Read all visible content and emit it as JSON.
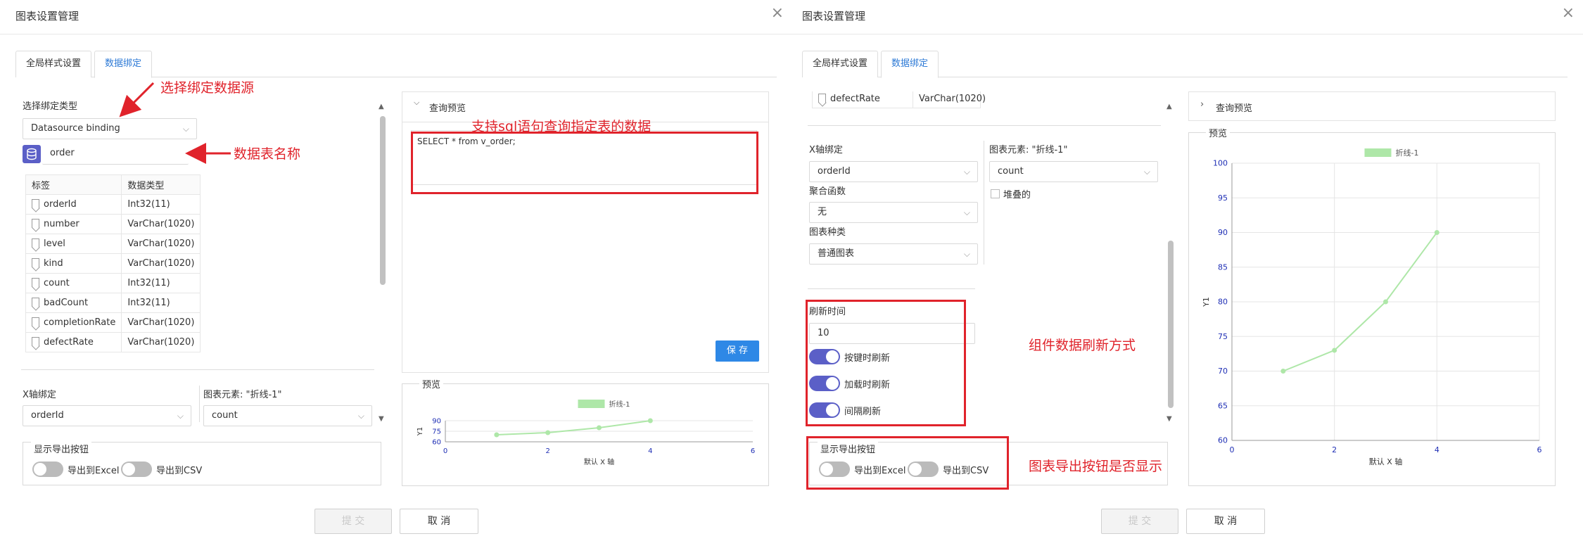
{
  "dialog_title": "图表设置管理",
  "close_symbol": "×",
  "tabs": [
    "全局样式设置",
    "数据绑定"
  ],
  "left": {
    "bind_type_label": "选择绑定类型",
    "bind_type_value": "Datasource binding",
    "table_name": "order",
    "columns_header": [
      "标签",
      "数据类型"
    ],
    "columns": [
      {
        "name": "orderId",
        "type": "Int32(11)"
      },
      {
        "name": "number",
        "type": "VarChar(1020)"
      },
      {
        "name": "level",
        "type": "VarChar(1020)"
      },
      {
        "name": "kind",
        "type": "VarChar(1020)"
      },
      {
        "name": "count",
        "type": "Int32(11)"
      },
      {
        "name": "badCount",
        "type": "Int32(11)"
      },
      {
        "name": "completionRate",
        "type": "VarChar(1020)"
      },
      {
        "name": "defectRate",
        "type": "VarChar(1020)"
      }
    ],
    "xaxis_label": "X轴绑定",
    "xaxis_value": "orderId",
    "element_label": "图表元素: \"折线-1\"",
    "element_value": "count",
    "export_legend": "显示导出按钮",
    "export_excel": "导出到Excel",
    "export_csv": "导出到CSV",
    "query_title": "查询预览",
    "sql": "SELECT * from v_order;",
    "save_label": "保 存",
    "preview_label": "预览"
  },
  "right": {
    "defect_row": {
      "name": "defectRate",
      "type": "VarChar(1020)"
    },
    "xaxis_label": "X轴绑定",
    "xaxis_value": "orderId",
    "element_label": "图表元素: \"折线-1\"",
    "element_value": "count",
    "agg_label": "聚合函数",
    "agg_value": "无",
    "stack_label": "堆叠的",
    "chart_kind_label": "图表种类",
    "chart_kind_value": "普通图表",
    "refresh_label": "刷新时间",
    "refresh_value": "10",
    "refresh_opts": [
      "按键时刷新",
      "加载时刷新",
      "间隔刷新"
    ],
    "export_legend": "显示导出按钮",
    "export_excel": "导出到Excel",
    "export_csv": "导出到CSV",
    "query_title": "查询预览",
    "preview_label": "预览"
  },
  "footer": {
    "submit": "提 交",
    "cancel": "取 消"
  },
  "annotations": {
    "a1": "选择绑定数据源",
    "a2": "数据表名称",
    "a3": "支持sql语句查询指定表的数据",
    "a4": "组件数据刷新方式",
    "a5": "图表导出按钮是否显示"
  },
  "colors": {
    "accent": "#2d7ad6",
    "toggle_on": "#5b5fc7",
    "annotation": "#e0232b",
    "line": "#aee7a8"
  },
  "chart_data": [
    {
      "type": "line",
      "series": [
        {
          "name": "折线-1",
          "x": [
            1,
            2,
            3,
            4
          ],
          "y": [
            70,
            73,
            80,
            90
          ]
        }
      ],
      "xlabel": "默认 X 轴",
      "ylabel": "Y1",
      "xlim": [
        0,
        6
      ],
      "xticks": [
        "0",
        "2",
        "4",
        "6"
      ],
      "ylim": [
        60,
        90
      ],
      "yticks": [
        "60",
        "75",
        "90"
      ],
      "legend": "top-center"
    },
    {
      "type": "line",
      "series": [
        {
          "name": "折线-1",
          "x": [
            1,
            2,
            3,
            4
          ],
          "y": [
            70,
            73,
            80,
            90
          ]
        }
      ],
      "xlabel": "默认 X 轴",
      "ylabel": "Y1",
      "xlim": [
        0,
        6
      ],
      "xticks": [
        "0",
        "2",
        "4",
        "6"
      ],
      "ylim": [
        60,
        100
      ],
      "yticks": [
        "60",
        "65",
        "70",
        "75",
        "80",
        "85",
        "90",
        "95",
        "100"
      ],
      "grid": true,
      "legend": "top-center"
    }
  ]
}
